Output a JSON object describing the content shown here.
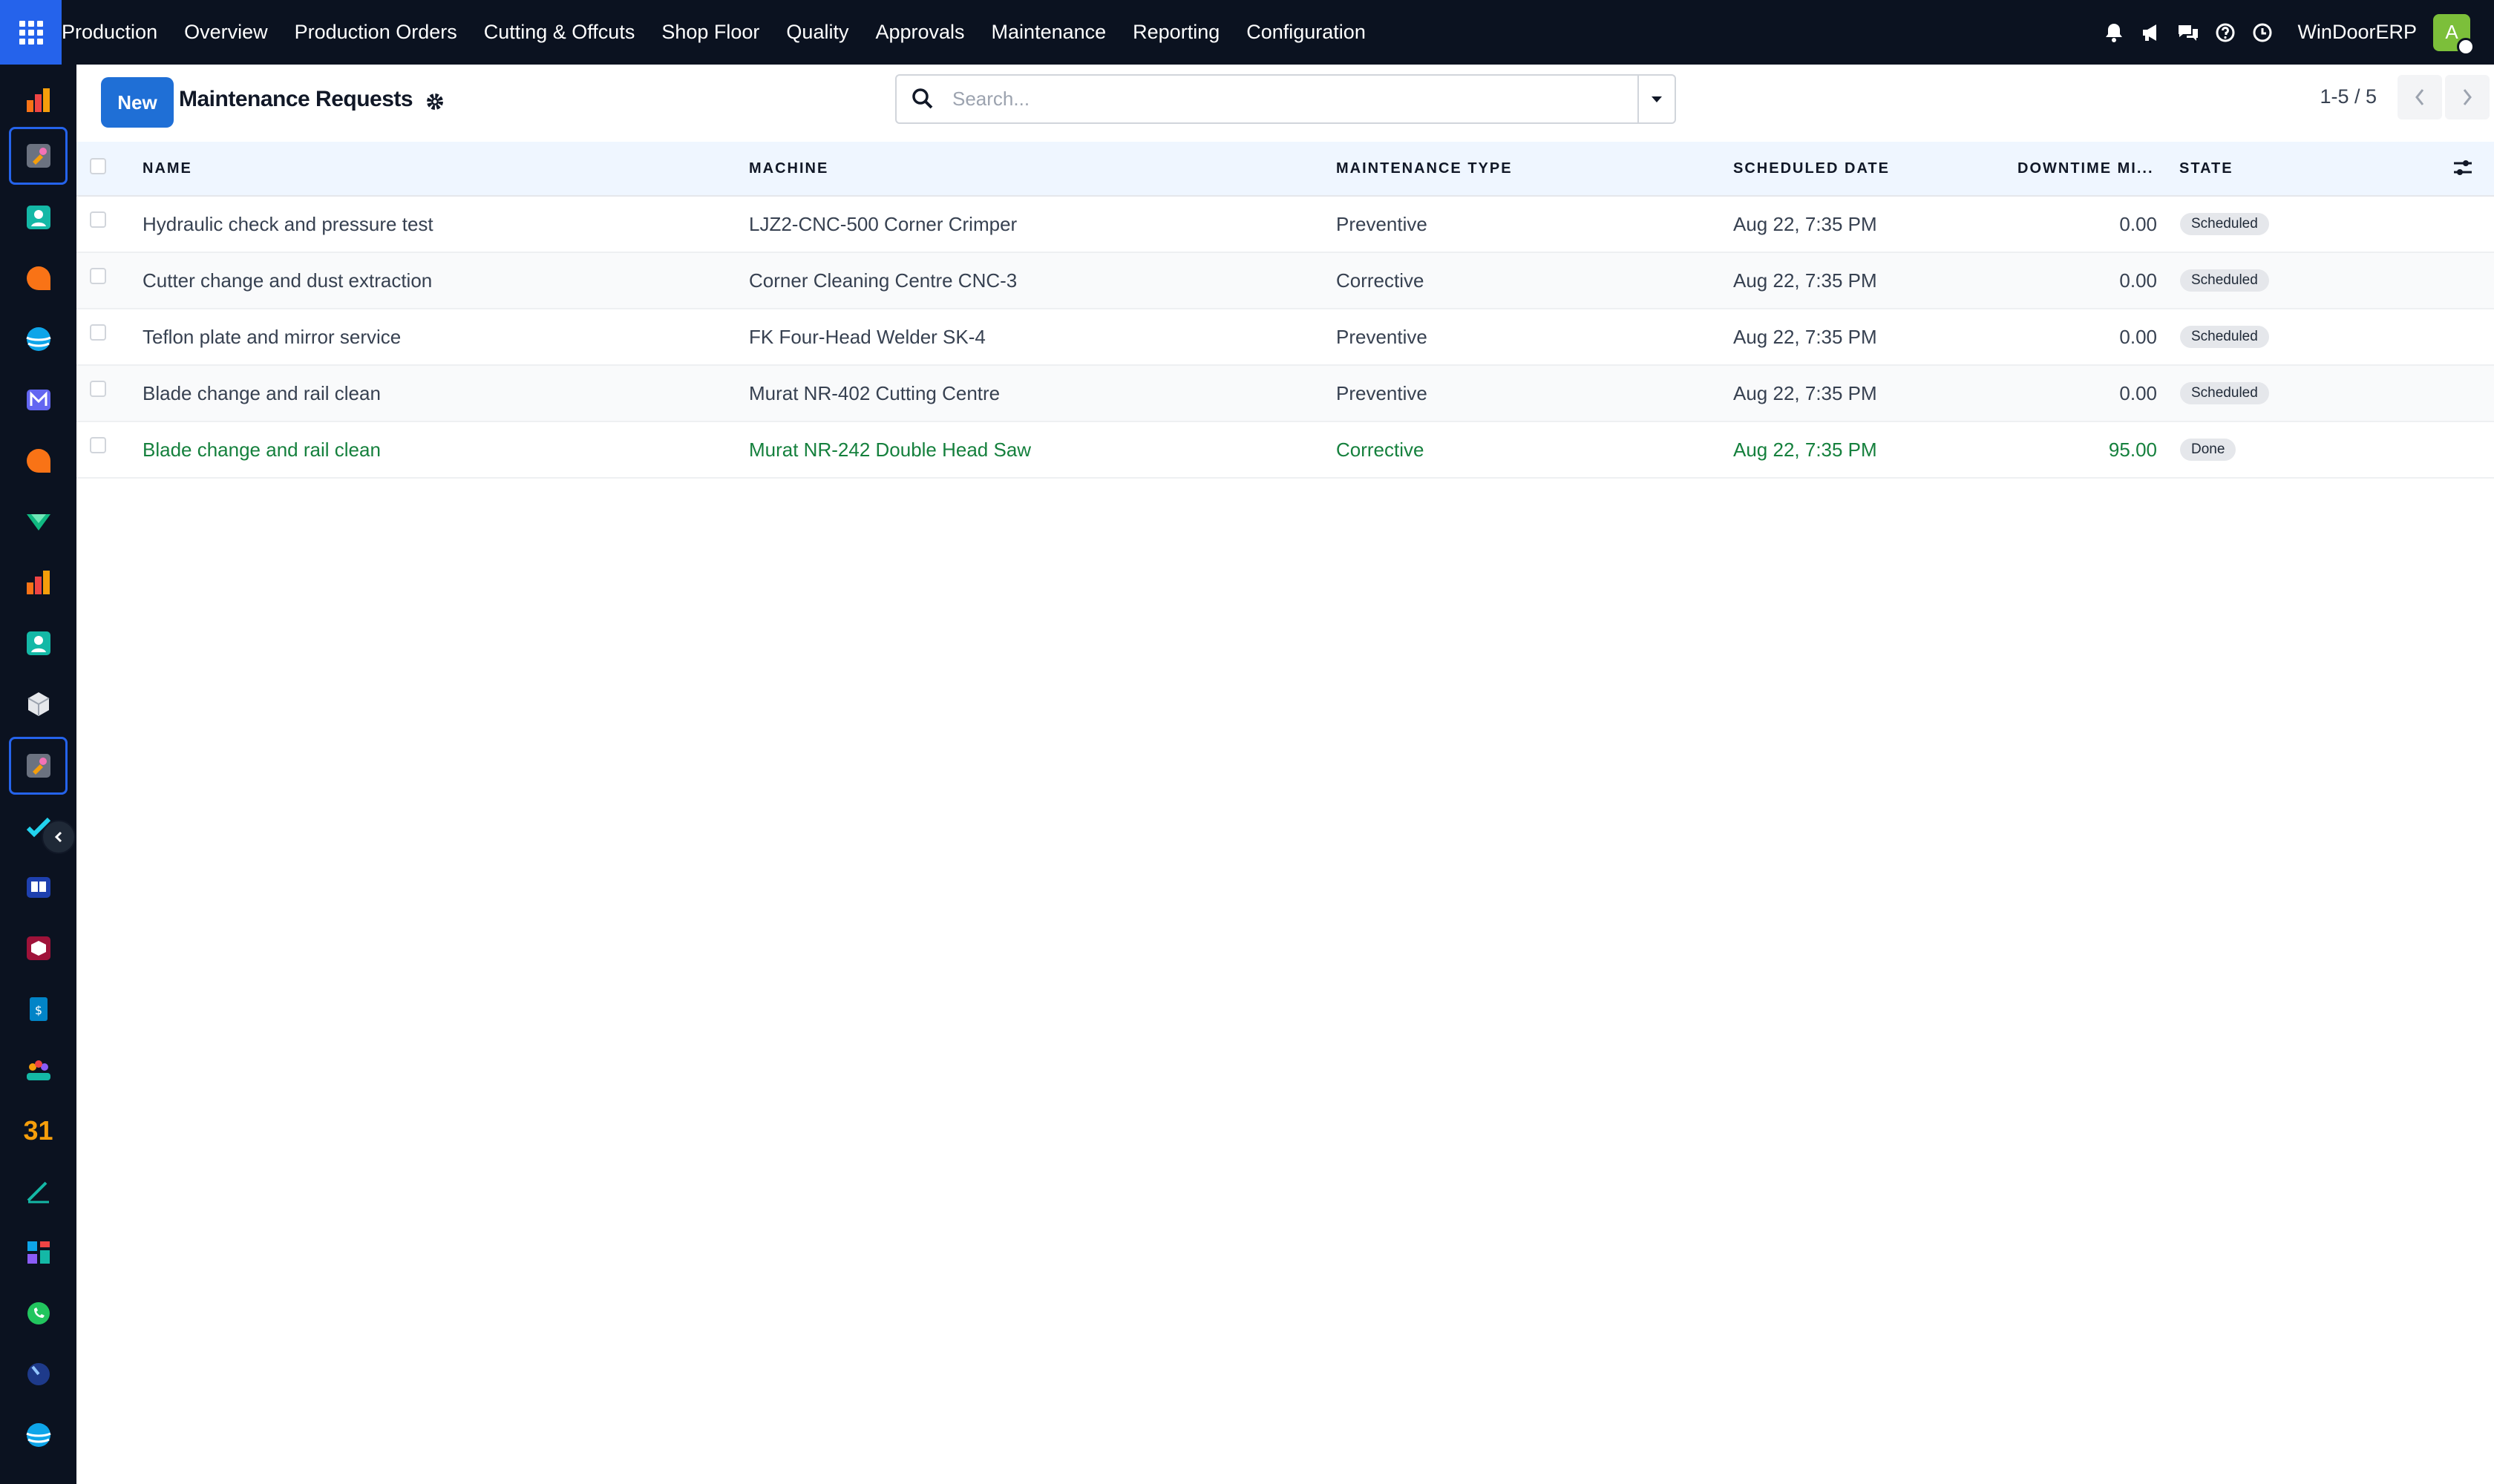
{
  "topbar": {
    "menu": [
      "Production",
      "Overview",
      "Production Orders",
      "Cutting & Offcuts",
      "Shop Floor",
      "Quality",
      "Approvals",
      "Maintenance",
      "Reporting",
      "Configuration"
    ],
    "company": "WinDoorERP",
    "avatar_initial": "A",
    "avatar_color": "#7cbf3a",
    "accent": "#2563eb",
    "icons": [
      "bell-icon",
      "megaphone-icon",
      "chat-icon",
      "help-icon",
      "clock-icon"
    ]
  },
  "rail": {
    "icons": [
      "manufacturing-app-icon",
      "maintenance-app-icon",
      "contacts-app-icon",
      "discuss-app-icon",
      "website-app-icon",
      "email-marketing-app-icon",
      "live-chat-app-icon",
      "sales-app-icon",
      "bar-chart-app-icon",
      "employees-app-icon",
      "inventory-app-icon",
      "maintenance-app-icon-2",
      "project-app-icon",
      "knowledge-app-icon",
      "product-app-icon",
      "invoicing-app-icon",
      "teams-app-icon",
      "calendar-app-icon",
      "sign-app-icon",
      "dashboards-app-icon",
      "whatsapp-app-icon",
      "time-off-app-icon",
      "website-app-icon-2"
    ],
    "calendar_label": "31"
  },
  "control": {
    "new_label": "New",
    "title": "Maintenance Requests",
    "search_placeholder": "Search...",
    "pager_text": "1-5 / 5"
  },
  "table": {
    "columns": [
      "NAME",
      "MACHINE",
      "MAINTENANCE TYPE",
      "SCHEDULED DATE",
      "DOWNTIME MI...",
      "STATE"
    ],
    "rows": [
      {
        "name": "Hydraulic check and pressure test",
        "machine": "LJZ2-CNC-500 Corner Crimper",
        "type": "Preventive",
        "date": "Aug 22, 7:35 PM",
        "downtime": "0.00",
        "state": "Scheduled",
        "done": false
      },
      {
        "name": "Cutter change and dust extraction",
        "machine": "Corner Cleaning Centre CNC-3",
        "type": "Corrective",
        "date": "Aug 22, 7:35 PM",
        "downtime": "0.00",
        "state": "Scheduled",
        "done": false
      },
      {
        "name": "Teflon plate and mirror service",
        "machine": "FK Four-Head Welder SK-4",
        "type": "Preventive",
        "date": "Aug 22, 7:35 PM",
        "downtime": "0.00",
        "state": "Scheduled",
        "done": false
      },
      {
        "name": "Blade change and rail clean",
        "machine": "Murat NR-402 Cutting Centre",
        "type": "Preventive",
        "date": "Aug 22, 7:35 PM",
        "downtime": "0.00",
        "state": "Scheduled",
        "done": false
      },
      {
        "name": "Blade change and rail clean",
        "machine": "Murat NR-242 Double Head Saw",
        "type": "Corrective",
        "date": "Aug 22, 7:35 PM",
        "downtime": "95.00",
        "state": "Done",
        "done": true
      }
    ],
    "done_color": "#15803d"
  }
}
